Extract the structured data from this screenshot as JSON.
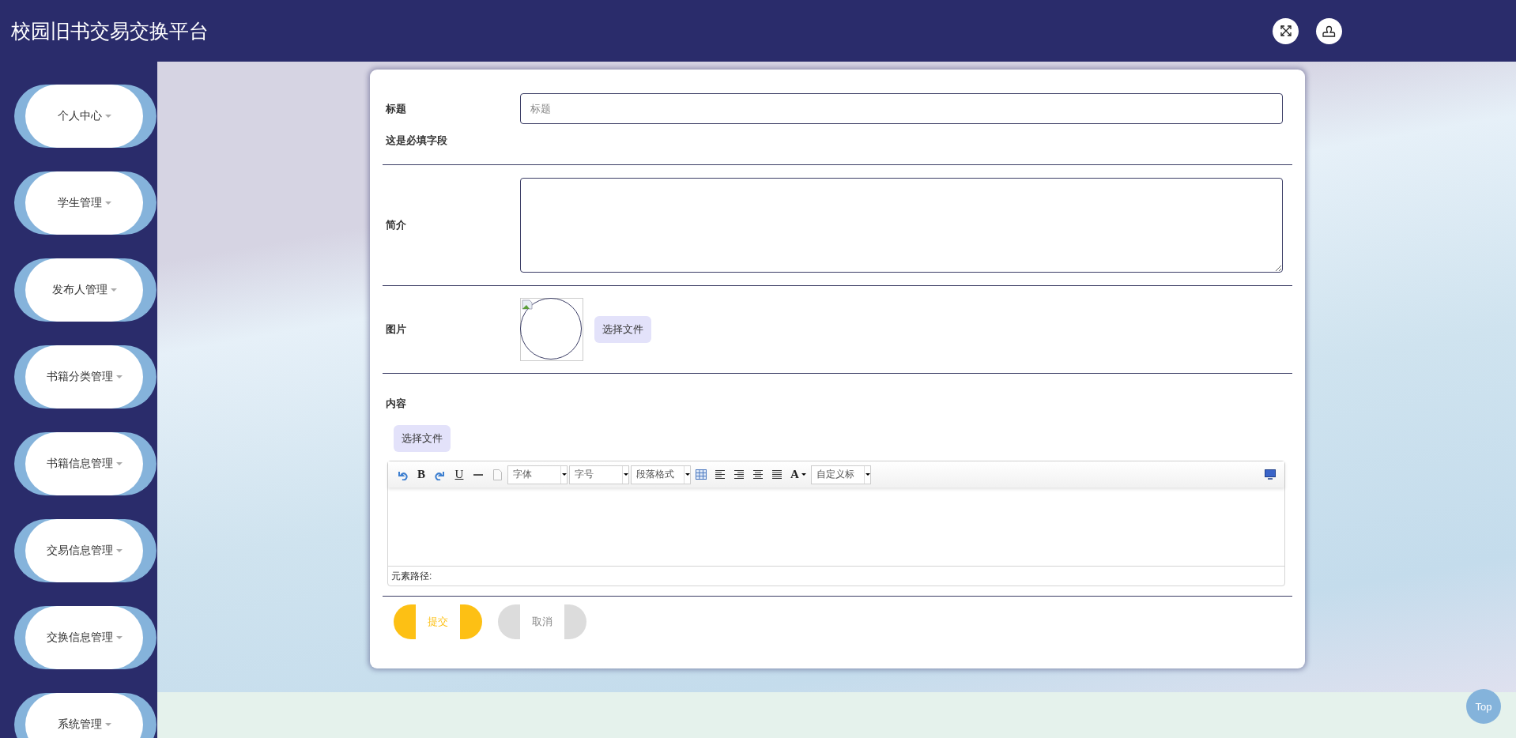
{
  "header": {
    "title": "校园旧书交易交换平台",
    "actions": [
      {
        "kind": "fullscreen"
      },
      {
        "kind": "user"
      }
    ]
  },
  "sidebar": {
    "items": [
      {
        "label": "个人中心"
      },
      {
        "label": "学生管理"
      },
      {
        "label": "发布人管理"
      },
      {
        "label": "书籍分类管理"
      },
      {
        "label": "书籍信息管理"
      },
      {
        "label": "交易信息管理"
      },
      {
        "label": "交换信息管理"
      },
      {
        "label": "系统管理"
      }
    ]
  },
  "form": {
    "fields": [
      {
        "kind": "input",
        "label": "标题",
        "placeholder": "标题",
        "hint": "这是必填字段"
      },
      {
        "kind": "textarea",
        "label": "简介"
      },
      {
        "kind": "image",
        "label": "图片",
        "button": "选择文件"
      },
      {
        "kind": "editor",
        "label": "内容",
        "button": "选择文件"
      }
    ],
    "editor": {
      "toolbar": [
        {
          "kind": "undo"
        },
        {
          "kind": "bold",
          "text": "B"
        },
        {
          "kind": "redo"
        },
        {
          "kind": "underline",
          "text": "U"
        },
        {
          "kind": "rule"
        },
        {
          "kind": "page"
        },
        {
          "kind": "select",
          "text": "字体"
        },
        {
          "kind": "select",
          "text": "字号"
        },
        {
          "kind": "select",
          "text": "段落格式"
        },
        {
          "kind": "table"
        },
        {
          "kind": "align-left"
        },
        {
          "kind": "align-right"
        },
        {
          "kind": "align-center"
        },
        {
          "kind": "justify"
        },
        {
          "kind": "color",
          "text": "A"
        },
        {
          "kind": "select",
          "text": "自定义标"
        },
        {
          "kind": "preview"
        }
      ],
      "path_label": "元素路径:"
    },
    "buttons": [
      {
        "kind": "submit",
        "label": "提交"
      },
      {
        "kind": "cancel",
        "label": "取消"
      }
    ]
  },
  "back_to_top": "Top"
}
